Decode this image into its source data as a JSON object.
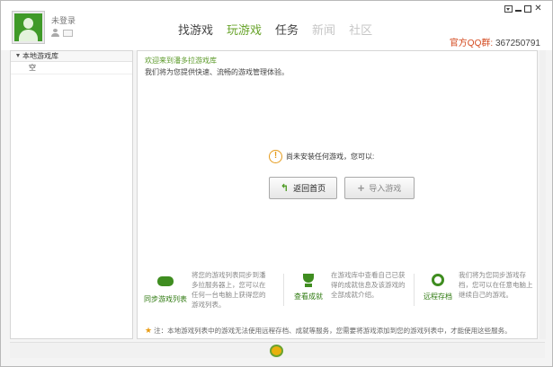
{
  "user": {
    "status": "未登录"
  },
  "nav": [
    {
      "label": "找游戏",
      "state": "normal"
    },
    {
      "label": "玩游戏",
      "state": "active"
    },
    {
      "label": "任务",
      "state": "normal"
    },
    {
      "label": "新闻",
      "state": "disabled"
    },
    {
      "label": "社区",
      "state": "disabled"
    }
  ],
  "qq_group": {
    "label": "官方QQ群:",
    "number": "367250791"
  },
  "window_controls": [
    "menu-icon",
    "minimize-icon",
    "maximize-icon",
    "close-icon"
  ],
  "sidebar": {
    "root_label": "本地游戏库",
    "items": [
      "空"
    ]
  },
  "main": {
    "welcome_title": "欢迎来到潘多拉游戏库",
    "welcome_subtitle": "我们将为您提供快速、流畅的游戏管理体验。",
    "notice": "尚未安装任何游戏，您可以:",
    "home_button": "返回首页",
    "import_button": "导入游戏"
  },
  "features": [
    {
      "icon": "gamepad-icon",
      "caption": "同步游戏列表",
      "description": "将您的游戏列表同步到潘多拉服务器上，您可以在任何一台电脑上获得您的游戏列表。"
    },
    {
      "icon": "trophy-icon",
      "caption": "查看成就",
      "description": "在游戏库中查看自己已获得的成就信息及该游戏的全部成就介绍。"
    },
    {
      "icon": "cloud-save-icon",
      "caption": "远程存档",
      "description": "我们将为您同步游戏存档，您可以在任意电脑上继续自己的游戏。"
    }
  ],
  "footnote": "注：本地游戏列表中的游戏无法使用远程存档、成就等服务，您需要将游戏添加到您的游戏列表中，才能使用这些服务。",
  "colors": {
    "accent": "#68a32a",
    "qq_label": "#d3481d",
    "notice": "#e59b1c"
  }
}
